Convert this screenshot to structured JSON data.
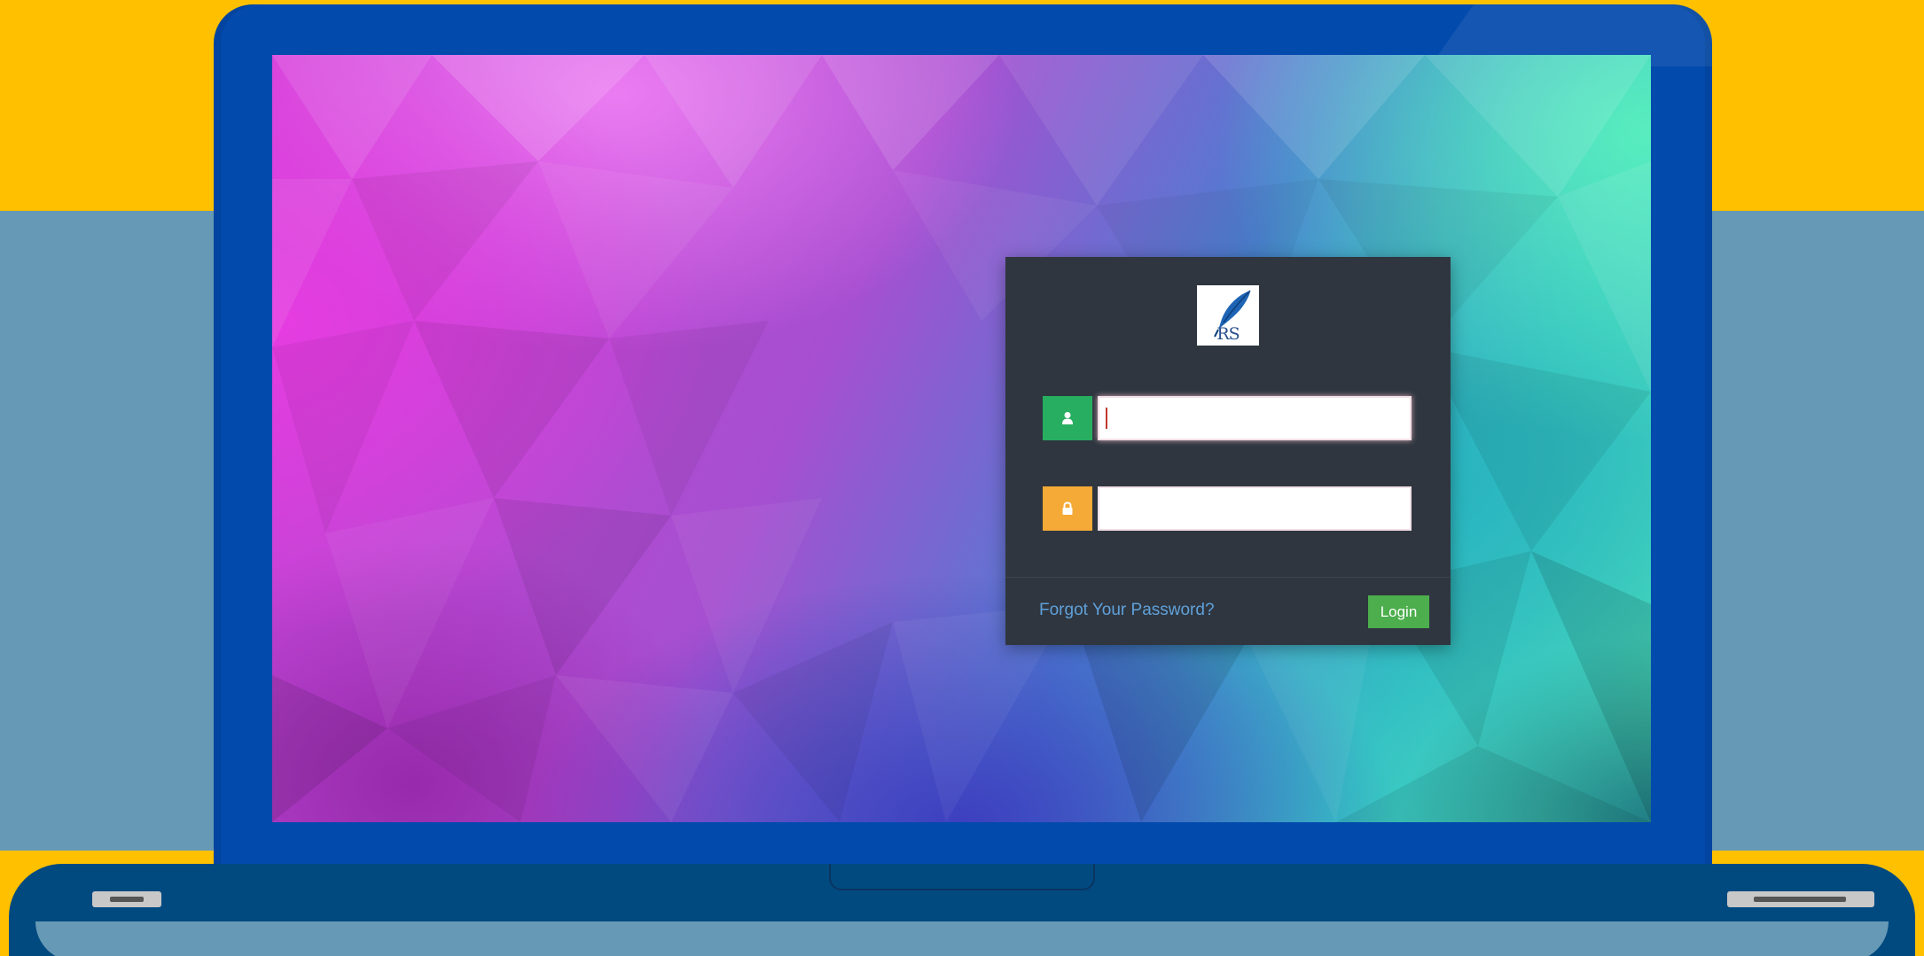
{
  "login": {
    "logo_text": "RS",
    "username": {
      "icon": "user-icon",
      "value": "",
      "placeholder": ""
    },
    "password": {
      "icon": "lock-icon",
      "value": "",
      "placeholder": ""
    },
    "forgot_password_label": "Forgot Your Password?",
    "login_button_label": "Login"
  },
  "colors": {
    "panel_bg": "#2f3640",
    "user_addon": "#27ae60",
    "password_addon": "#f5a937",
    "login_button": "#4cae4c",
    "link": "#5fa0d9",
    "laptop_frame": "#034aad",
    "background_accent": "#ffc000"
  }
}
